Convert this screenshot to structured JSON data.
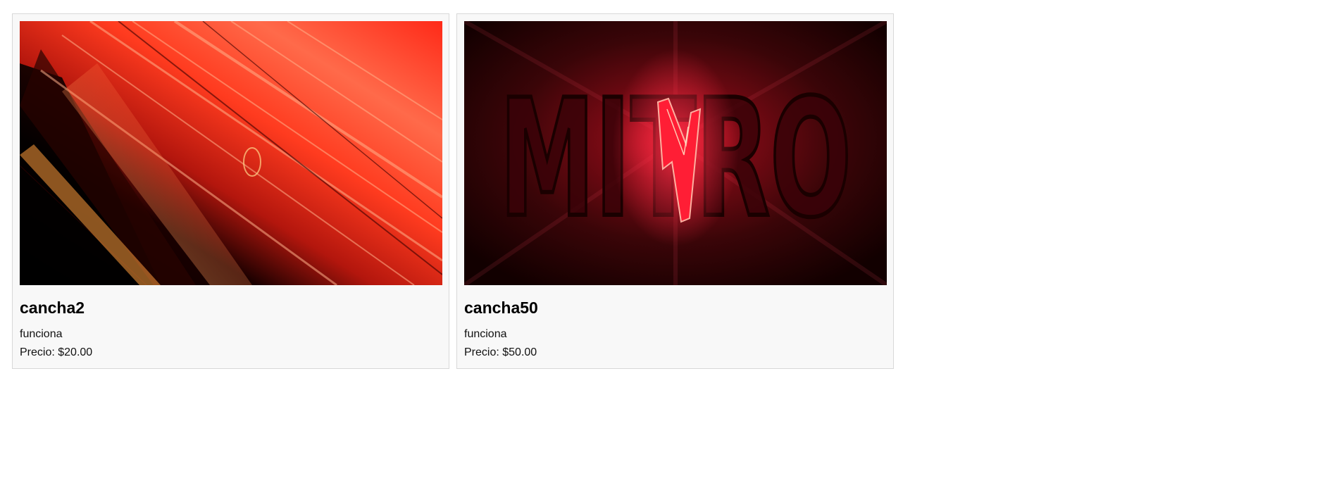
{
  "products": [
    {
      "name": "cancha2",
      "description": "funciona",
      "price_label": "Precio: $20.00",
      "image": "red-abstract-streaks-image",
      "colors": {
        "primary": "#ff3b1f",
        "dark": "#000000",
        "glow": "#ff8a3a"
      }
    },
    {
      "name": "cancha50",
      "description": "funciona",
      "price_label": "Precio: $50.00",
      "image": "mitro-logo-image",
      "image_text": "MITRO",
      "colors": {
        "primary": "#d0162a",
        "dark": "#120000",
        "glow": "#ff2d45"
      }
    }
  ]
}
